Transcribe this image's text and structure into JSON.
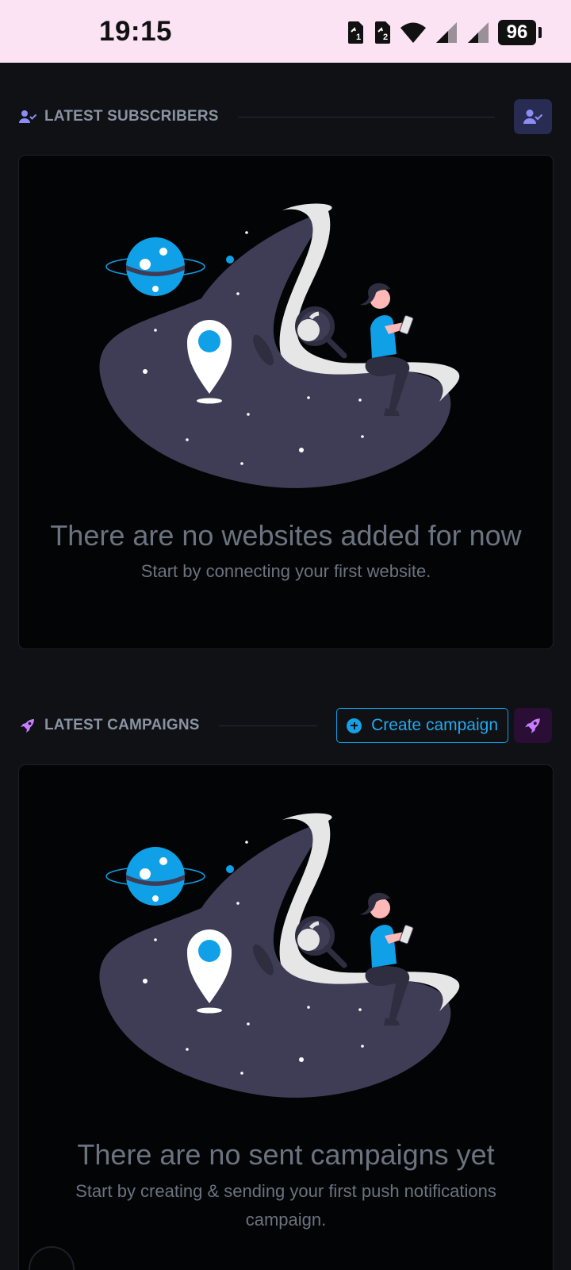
{
  "status_bar": {
    "time": "19:15",
    "battery": "96"
  },
  "subscribers": {
    "title": "LATEST SUBSCRIBERS"
  },
  "websites_empty": {
    "title": "There are no websites added for now",
    "subtitle": "Start by connecting your first website."
  },
  "campaigns": {
    "title": "LATEST CAMPAIGNS",
    "create_label": "Create campaign"
  },
  "campaigns_empty": {
    "title": "There are no sent campaigns yet",
    "subtitle": "Start by creating & sending your first push notifications campaign."
  },
  "colors": {
    "accent": "#0fa0e8",
    "rocket": "#c77dff",
    "subscribers_icon": "#8b8cf5",
    "blob": "#3f3d56"
  }
}
